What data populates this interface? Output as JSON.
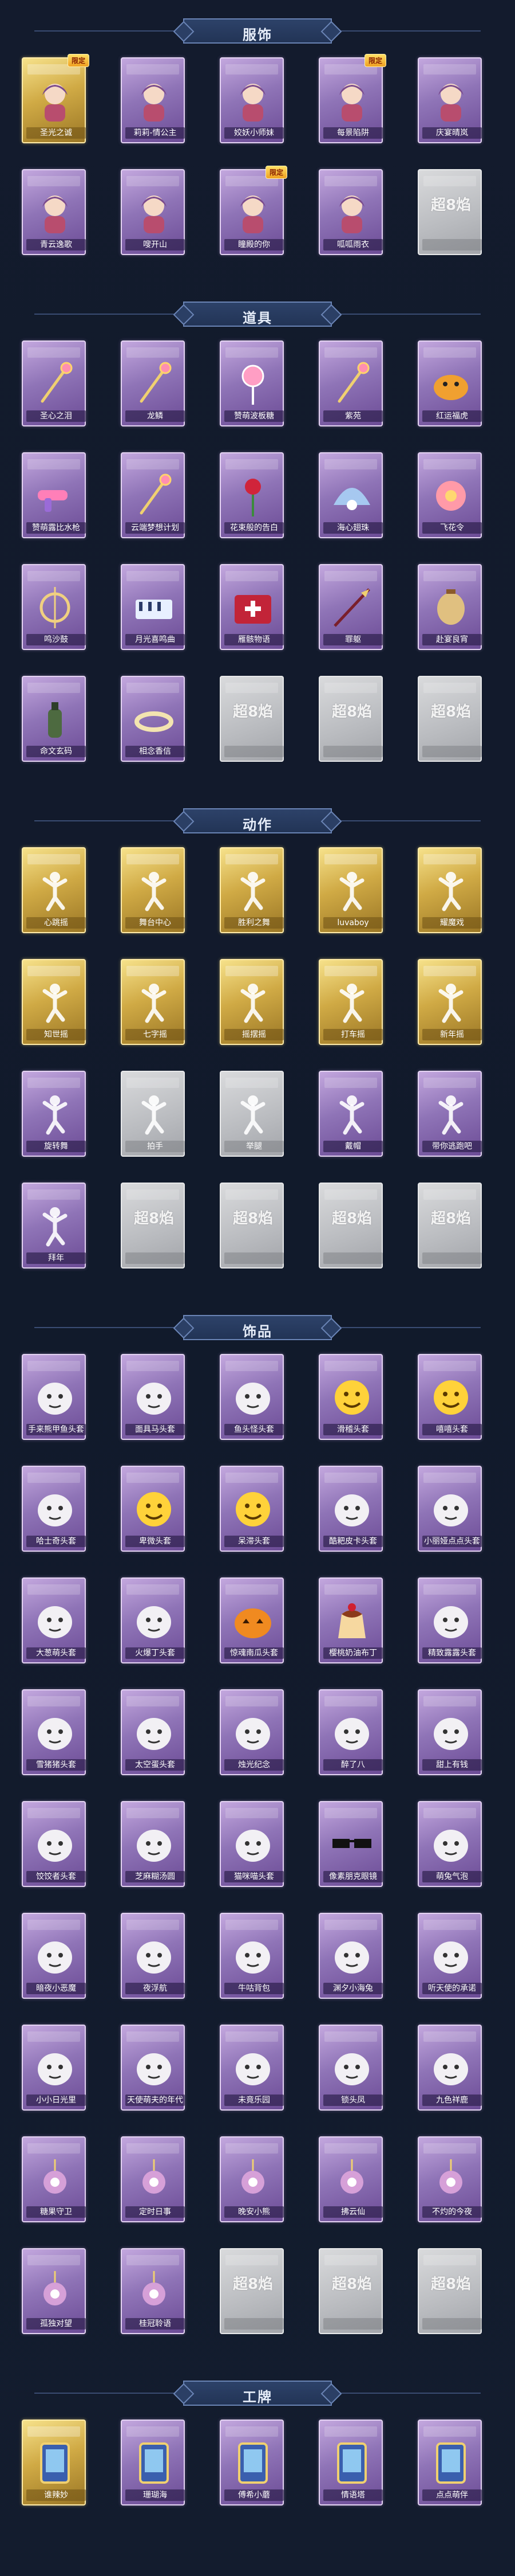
{
  "sections": [
    {
      "title": "服饰",
      "items": [
        {
          "label": "圣光之诚",
          "frame": "gold",
          "badge": "限定",
          "icon": "character-icon"
        },
        {
          "label": "莉莉-情公主",
          "frame": "purple",
          "badge": "",
          "icon": "character-icon"
        },
        {
          "label": "姣妖小师妹",
          "frame": "purple",
          "badge": "",
          "icon": "character-icon"
        },
        {
          "label": "每景陷阱",
          "frame": "purple",
          "badge": "限定",
          "icon": "character-icon"
        },
        {
          "label": "庆宴晴岚",
          "frame": "purple",
          "badge": "",
          "icon": "character-icon"
        },
        {
          "label": "青云逸歌",
          "frame": "purple",
          "badge": "",
          "icon": "character-icon"
        },
        {
          "label": "嗖开山",
          "frame": "purple",
          "badge": "",
          "icon": "character-icon"
        },
        {
          "label": "瞳殿的你",
          "frame": "purple",
          "badge": "限定",
          "icon": "character-icon"
        },
        {
          "label": "呱呱雨衣",
          "frame": "purple",
          "badge": "",
          "icon": "character-icon"
        },
        {
          "label": "",
          "frame": "gray",
          "badge": "",
          "icon": "placeholder-logo"
        }
      ]
    },
    {
      "title": "道具",
      "items": [
        {
          "label": "圣心之泪",
          "frame": "purple",
          "badge": "",
          "icon": "wand-icon"
        },
        {
          "label": "龙鳞",
          "frame": "purple",
          "badge": "",
          "icon": "wand-icon"
        },
        {
          "label": "赞萌波板糖",
          "frame": "purple",
          "badge": "",
          "icon": "lollipop-icon"
        },
        {
          "label": "紫苑",
          "frame": "purple",
          "badge": "",
          "icon": "wand-icon"
        },
        {
          "label": "红运福虎",
          "frame": "purple",
          "badge": "",
          "icon": "tiger-icon"
        },
        {
          "label": "赞萌露比水枪",
          "frame": "purple",
          "badge": "",
          "icon": "gun-icon"
        },
        {
          "label": "云端梦想计划",
          "frame": "purple",
          "badge": "",
          "icon": "wand-icon"
        },
        {
          "label": "花束般的告白",
          "frame": "purple",
          "badge": "",
          "icon": "rose-icon"
        },
        {
          "label": "海心翅珠",
          "frame": "purple",
          "badge": "",
          "icon": "shell-icon"
        },
        {
          "label": "飞花令",
          "frame": "purple",
          "badge": "",
          "icon": "flower-icon"
        },
        {
          "label": "鸣沙鼓",
          "frame": "purple",
          "badge": "",
          "icon": "drum-icon"
        },
        {
          "label": "月光喜鸣曲",
          "frame": "purple",
          "badge": "",
          "icon": "piano-icon"
        },
        {
          "label": "雁骸物语",
          "frame": "purple",
          "badge": "",
          "icon": "box-icon"
        },
        {
          "label": "罪躯",
          "frame": "purple",
          "badge": "",
          "icon": "spear-icon"
        },
        {
          "label": "赴宴良宵",
          "frame": "purple",
          "badge": "",
          "icon": "lantern-icon"
        },
        {
          "label": "命文玄码",
          "frame": "purple",
          "badge": "",
          "icon": "bottle-icon"
        },
        {
          "label": "相念香信",
          "frame": "purple",
          "badge": "",
          "icon": "ring-icon"
        },
        {
          "label": "",
          "frame": "gray",
          "badge": "",
          "icon": "placeholder-logo"
        },
        {
          "label": "",
          "frame": "gray",
          "badge": "",
          "icon": "placeholder-logo"
        },
        {
          "label": "",
          "frame": "gray",
          "badge": "",
          "icon": "placeholder-logo"
        }
      ]
    },
    {
      "title": "动作",
      "items": [
        {
          "label": "心跳摇",
          "frame": "gold",
          "badge": "",
          "icon": "pose-icon"
        },
        {
          "label": "舞台中心",
          "frame": "gold",
          "badge": "",
          "icon": "pose-icon"
        },
        {
          "label": "胜利之舞",
          "frame": "gold",
          "badge": "",
          "icon": "pose-icon"
        },
        {
          "label": "luvaboy",
          "frame": "gold",
          "badge": "",
          "icon": "pose-icon"
        },
        {
          "label": "耀魔戏",
          "frame": "gold",
          "badge": "",
          "icon": "pose-icon"
        },
        {
          "label": "知世摇",
          "frame": "gold",
          "badge": "",
          "icon": "pose-icon"
        },
        {
          "label": "七字摇",
          "frame": "gold",
          "badge": "",
          "icon": "pose-icon"
        },
        {
          "label": "摇摆摇",
          "frame": "gold",
          "badge": "",
          "icon": "pose-icon"
        },
        {
          "label": "打车摇",
          "frame": "gold",
          "badge": "",
          "icon": "pose-icon"
        },
        {
          "label": "新年摇",
          "frame": "gold",
          "badge": "",
          "icon": "pose-icon"
        },
        {
          "label": "旋转舞",
          "frame": "purple",
          "badge": "",
          "icon": "pose-icon"
        },
        {
          "label": "拍手",
          "frame": "gray",
          "badge": "",
          "icon": "pose-icon"
        },
        {
          "label": "举腿",
          "frame": "gray",
          "badge": "",
          "icon": "pose-icon"
        },
        {
          "label": "戴帽",
          "frame": "purple",
          "badge": "",
          "icon": "pose-icon"
        },
        {
          "label": "带你逃跑吧",
          "frame": "purple",
          "badge": "",
          "icon": "pose-icon"
        },
        {
          "label": "拜年",
          "frame": "purple",
          "badge": "",
          "icon": "pose-icon"
        },
        {
          "label": "",
          "frame": "gray",
          "badge": "",
          "icon": "placeholder-logo"
        },
        {
          "label": "",
          "frame": "gray",
          "badge": "",
          "icon": "placeholder-logo"
        },
        {
          "label": "",
          "frame": "gray",
          "badge": "",
          "icon": "placeholder-logo"
        },
        {
          "label": "",
          "frame": "gray",
          "badge": "",
          "icon": "placeholder-logo"
        }
      ]
    },
    {
      "title": "饰品",
      "items": [
        {
          "label": "手来熊甲鱼头套",
          "frame": "purple",
          "badge": "",
          "icon": "head-icon"
        },
        {
          "label": "面具马头套",
          "frame": "purple",
          "badge": "",
          "icon": "head-icon"
        },
        {
          "label": "鱼头怪头套",
          "frame": "purple",
          "badge": "",
          "icon": "head-icon"
        },
        {
          "label": "滑稽头套",
          "frame": "purple",
          "badge": "",
          "icon": "emoji-icon"
        },
        {
          "label": "嘻嘻头套",
          "frame": "purple",
          "badge": "",
          "icon": "emoji-icon"
        },
        {
          "label": "哈士奇头套",
          "frame": "purple",
          "badge": "",
          "icon": "head-icon"
        },
        {
          "label": "卑微头套",
          "frame": "purple",
          "badge": "",
          "icon": "emoji-icon"
        },
        {
          "label": "呆滞头套",
          "frame": "purple",
          "badge": "",
          "icon": "emoji-icon"
        },
        {
          "label": "酷耙皮卡头套",
          "frame": "purple",
          "badge": "",
          "icon": "head-icon"
        },
        {
          "label": "小丽娅点点头套",
          "frame": "purple",
          "badge": "",
          "icon": "head-icon"
        },
        {
          "label": "大葱萌头套",
          "frame": "purple",
          "badge": "",
          "icon": "head-icon"
        },
        {
          "label": "火爆丁头套",
          "frame": "purple",
          "badge": "",
          "icon": "head-icon"
        },
        {
          "label": "惊魂南瓜头套",
          "frame": "purple",
          "badge": "",
          "icon": "pumpkin-icon"
        },
        {
          "label": "樱桃奶油布丁",
          "frame": "purple",
          "badge": "",
          "icon": "pudding-icon"
        },
        {
          "label": "精致露露头套",
          "frame": "purple",
          "badge": "",
          "icon": "head-icon"
        },
        {
          "label": "雪猪猪头套",
          "frame": "purple",
          "badge": "",
          "icon": "head-icon"
        },
        {
          "label": "太空蛋头套",
          "frame": "purple",
          "badge": "",
          "icon": "head-icon"
        },
        {
          "label": "烛光纪念",
          "frame": "purple",
          "badge": "",
          "icon": "head-icon"
        },
        {
          "label": "醉了八",
          "frame": "purple",
          "badge": "",
          "icon": "head-icon"
        },
        {
          "label": "甜上有钱",
          "frame": "purple",
          "badge": "",
          "icon": "head-icon"
        },
        {
          "label": "饺饺者头套",
          "frame": "purple",
          "badge": "",
          "icon": "head-icon"
        },
        {
          "label": "芝麻糊汤圆",
          "frame": "purple",
          "badge": "",
          "icon": "head-icon"
        },
        {
          "label": "猫咪喵头套",
          "frame": "purple",
          "badge": "",
          "icon": "head-icon"
        },
        {
          "label": "像素朋克眼镜",
          "frame": "purple",
          "badge": "",
          "icon": "glasses-icon"
        },
        {
          "label": "萌兔气泡",
          "frame": "purple",
          "badge": "",
          "icon": "head-icon"
        },
        {
          "label": "暗夜小恶魔",
          "frame": "purple",
          "badge": "",
          "icon": "head-icon"
        },
        {
          "label": "夜浮航",
          "frame": "purple",
          "badge": "",
          "icon": "head-icon"
        },
        {
          "label": "牛咕背包",
          "frame": "purple",
          "badge": "",
          "icon": "head-icon"
        },
        {
          "label": "渊夕小海兔",
          "frame": "purple",
          "badge": "",
          "icon": "head-icon"
        },
        {
          "label": "听天使的承诺",
          "frame": "purple",
          "badge": "",
          "icon": "head-icon"
        },
        {
          "label": "小小日光里",
          "frame": "purple",
          "badge": "",
          "icon": "head-icon"
        },
        {
          "label": "天使萌夫的年代",
          "frame": "purple",
          "badge": "",
          "icon": "head-icon"
        },
        {
          "label": "未竟乐园",
          "frame": "purple",
          "badge": "",
          "icon": "head-icon"
        },
        {
          "label": "锁头凤",
          "frame": "purple",
          "badge": "",
          "icon": "head-icon"
        },
        {
          "label": "九色祥鹿",
          "frame": "purple",
          "badge": "",
          "icon": "head-icon"
        },
        {
          "label": "糖果守卫",
          "frame": "purple",
          "badge": "",
          "icon": "charm-icon"
        },
        {
          "label": "定时日事",
          "frame": "purple",
          "badge": "",
          "icon": "charm-icon"
        },
        {
          "label": "晚安小熊",
          "frame": "purple",
          "badge": "",
          "icon": "charm-icon"
        },
        {
          "label": "拂云仙",
          "frame": "purple",
          "badge": "",
          "icon": "charm-icon"
        },
        {
          "label": "不灼的今夜",
          "frame": "purple",
          "badge": "",
          "icon": "charm-icon"
        },
        {
          "label": "孤独对望",
          "frame": "purple",
          "badge": "",
          "icon": "charm-icon"
        },
        {
          "label": "桂冠聆语",
          "frame": "purple",
          "badge": "",
          "icon": "charm-icon"
        },
        {
          "label": "",
          "frame": "gray",
          "badge": "",
          "icon": "placeholder-logo"
        },
        {
          "label": "",
          "frame": "gray",
          "badge": "",
          "icon": "placeholder-logo"
        },
        {
          "label": "",
          "frame": "gray",
          "badge": "",
          "icon": "placeholder-logo"
        }
      ]
    },
    {
      "title": "工牌",
      "items": [
        {
          "label": "谁辣妙",
          "frame": "gold",
          "badge": "",
          "icon": "card-icon"
        },
        {
          "label": "珊瑚海",
          "frame": "purple",
          "badge": "",
          "icon": "card-icon"
        },
        {
          "label": "傅希小蘑",
          "frame": "purple",
          "badge": "",
          "icon": "card-icon"
        },
        {
          "label": "情语塔",
          "frame": "purple",
          "badge": "",
          "icon": "card-icon"
        },
        {
          "label": "点点萌伴",
          "frame": "purple",
          "badge": "",
          "icon": "card-icon"
        }
      ]
    }
  ],
  "placeholder_text": "超8焰",
  "colors": {
    "background": "#121a2b",
    "banner": "#2d4269",
    "banner_border": "#6a84b5",
    "frame_purple": "#8f74b7",
    "frame_gold": "#d0aa45",
    "frame_gray": "#b9bbbf"
  }
}
